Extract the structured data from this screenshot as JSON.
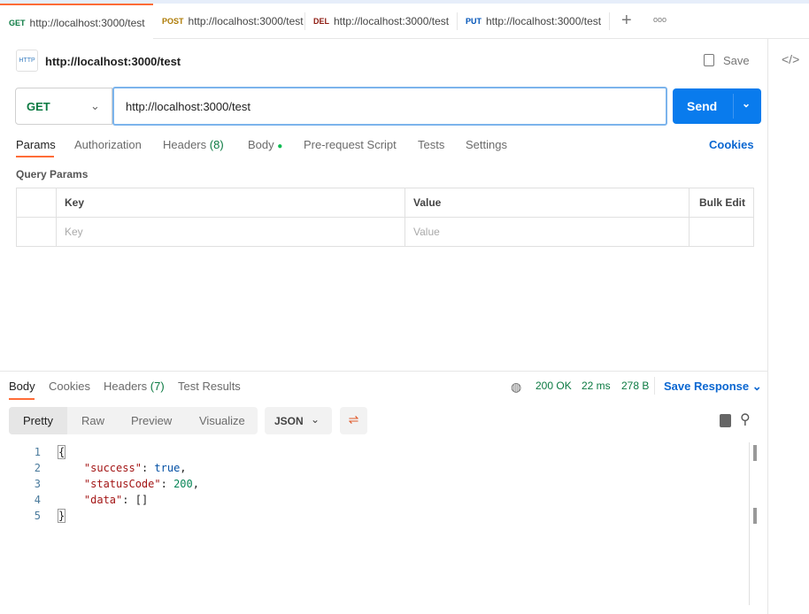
{
  "tabs": [
    {
      "method": "GET",
      "url": "http://localhost:3000/test",
      "color": "#0b7a42",
      "active": true
    },
    {
      "method": "POST",
      "url": "http://localhost:3000/test",
      "color": "#ad7a03"
    },
    {
      "method": "DEL",
      "url": "http://localhost:3000/test",
      "color": "#8e1a10"
    },
    {
      "method": "PUT",
      "url": "http://localhost:3000/test",
      "color": "#0053b8"
    }
  ],
  "tab_icons": {
    "add": "+",
    "more": "ooo"
  },
  "request": {
    "title": "http://localhost:3000/test",
    "save": "Save",
    "method": "GET",
    "url": "http://localhost:3000/test",
    "send": "Send"
  },
  "request_tabs": {
    "params": "Params",
    "authorization": "Authorization",
    "headers": "Headers",
    "headers_count": "(8)",
    "body": "Body",
    "prerequest": "Pre-request Script",
    "tests": "Tests",
    "settings": "Settings",
    "cookies": "Cookies"
  },
  "query_params": {
    "title": "Query Params",
    "headers": {
      "key": "Key",
      "value": "Value",
      "bulk": "Bulk Edit"
    },
    "placeholder": {
      "key": "Key",
      "value": "Value"
    }
  },
  "response": {
    "tabs": {
      "body": "Body",
      "cookies": "Cookies",
      "headers": "Headers",
      "headers_count": "(7)",
      "tests": "Test Results"
    },
    "status": "200 OK",
    "time": "22 ms",
    "size": "278 B",
    "save": "Save Response",
    "views": [
      "Pretty",
      "Raw",
      "Preview",
      "Visualize"
    ],
    "format": "JSON",
    "lines": [
      "{",
      "    \"success\": true,",
      "    \"statusCode\": 200,",
      "    \"data\": []",
      "}"
    ]
  }
}
